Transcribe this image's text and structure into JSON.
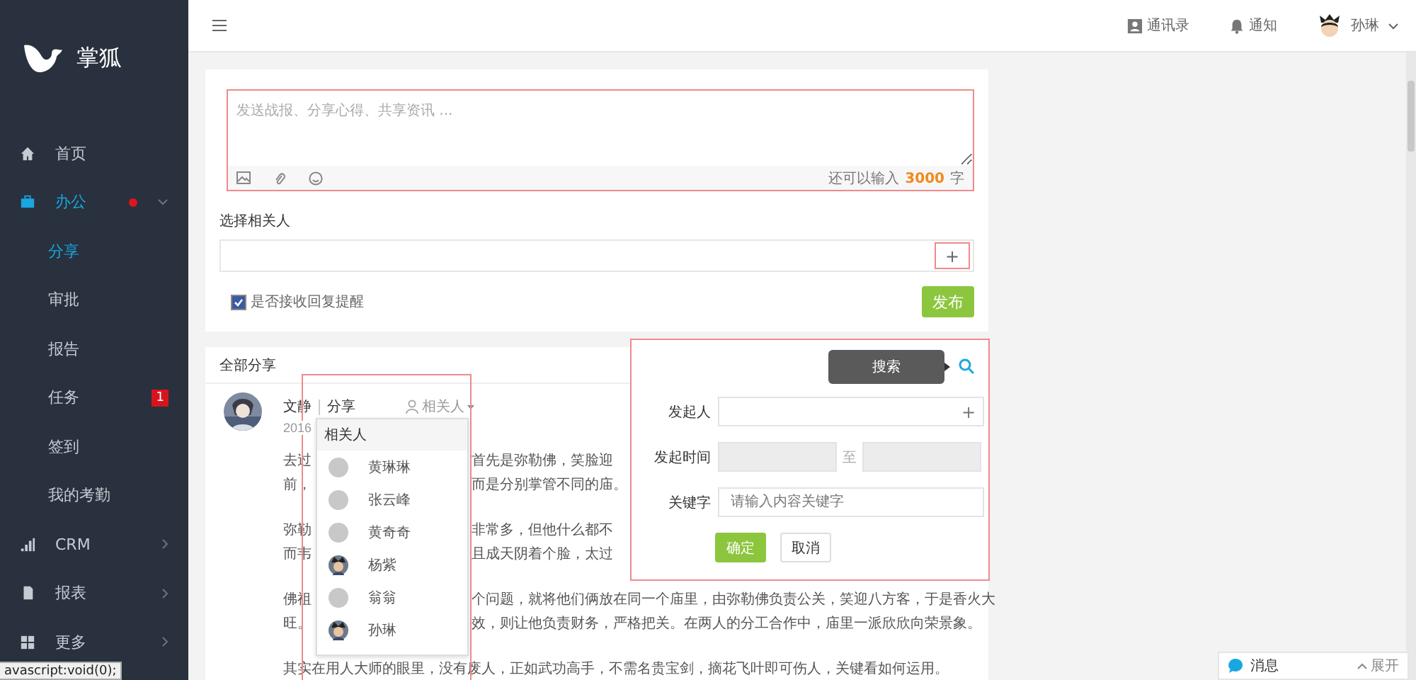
{
  "status_tip": "avascript:void(0);",
  "sidebar": {
    "logo": "掌狐",
    "items": [
      {
        "label": "首页",
        "selected": false,
        "dot": false
      },
      {
        "label": "办公",
        "selected": true,
        "dot": true,
        "expanded": true,
        "children": [
          {
            "label": "分享",
            "selected": true
          },
          {
            "label": "审批",
            "selected": false
          },
          {
            "label": "报告",
            "selected": false
          },
          {
            "label": "任务",
            "selected": false,
            "badge": "1"
          },
          {
            "label": "签到",
            "selected": false
          },
          {
            "label": "我的考勤",
            "selected": false
          }
        ]
      },
      {
        "label": "CRM",
        "selected": false,
        "dot": false,
        "expanded": false
      },
      {
        "label": "报表",
        "selected": false,
        "dot": false,
        "expanded": false
      },
      {
        "label": "更多",
        "selected": false,
        "dot": false,
        "expanded": false
      }
    ]
  },
  "topbar": {
    "links": [
      {
        "label": "通讯录"
      },
      {
        "label": "通知"
      }
    ],
    "user": "孙琳"
  },
  "composer": {
    "placeholder": "发送战报、分享心得、共享资讯 ...",
    "remaining_prefix": "还可以输入",
    "remaining": "3000",
    "remaining_suffix": "字",
    "related_label": "选择相关人",
    "add": "+",
    "reply_reminder": {
      "label": "是否接收回复提醒",
      "checked": true
    },
    "publish": "发布"
  },
  "feed": {
    "title": "全部分享",
    "post": {
      "author": "文静",
      "category": "分享",
      "related": "相关人",
      "date": "2016",
      "paragraphs": [
        {
          "lines": [
            {
              "left": "去过",
              "right": "首先是弥勒佛，笑脸迎"
            },
            {
              "left": "前，",
              "right": "而是分别掌管不同的庙。"
            }
          ]
        },
        {
          "lines": [
            {
              "left": "弥勒",
              "right": "非常多，但他什么都不"
            },
            {
              "left": "而韦",
              "right": "且成天阴着个脸，太过"
            }
          ]
        },
        {
          "lines": [
            {
              "left": "佛祖",
              "right": "个问题，就将他们俩放在同一个庙里，由弥勒佛负责公关，笑迎八方客，于是香火大"
            },
            {
              "left": "旺。",
              "right": "效，则让他负责财务，严格把关。在两人的分工合作中，庙里一派欣欣向荣景象。"
            }
          ]
        },
        {
          "lines": [
            {
              "text": "其实在用人大师的眼里，没有废人，正如武功高手，不需名贵宝剑，摘花飞叶即可伤人，关键看如何运用。"
            }
          ]
        }
      ]
    },
    "related_menu": {
      "title": "相关人",
      "people": [
        {
          "name": "黄琳琳",
          "kind": "placeholder"
        },
        {
          "name": "张云峰",
          "kind": "placeholder"
        },
        {
          "name": "黄奇奇",
          "kind": "placeholder"
        },
        {
          "name": "杨紫"
        },
        {
          "name": "翁翁",
          "kind": "placeholder"
        },
        {
          "name": "孙琳"
        }
      ]
    },
    "search": {
      "tooltip": "搜索",
      "initiator_label": "发起人",
      "add": "+",
      "time_label": "发起时间",
      "to": "至",
      "keyword_label": "关键字",
      "keyword_placeholder": "请输入内容关键字",
      "confirm": "确定",
      "cancel": "取消"
    }
  },
  "message_bar": {
    "label": "消息",
    "expand": "展开"
  }
}
